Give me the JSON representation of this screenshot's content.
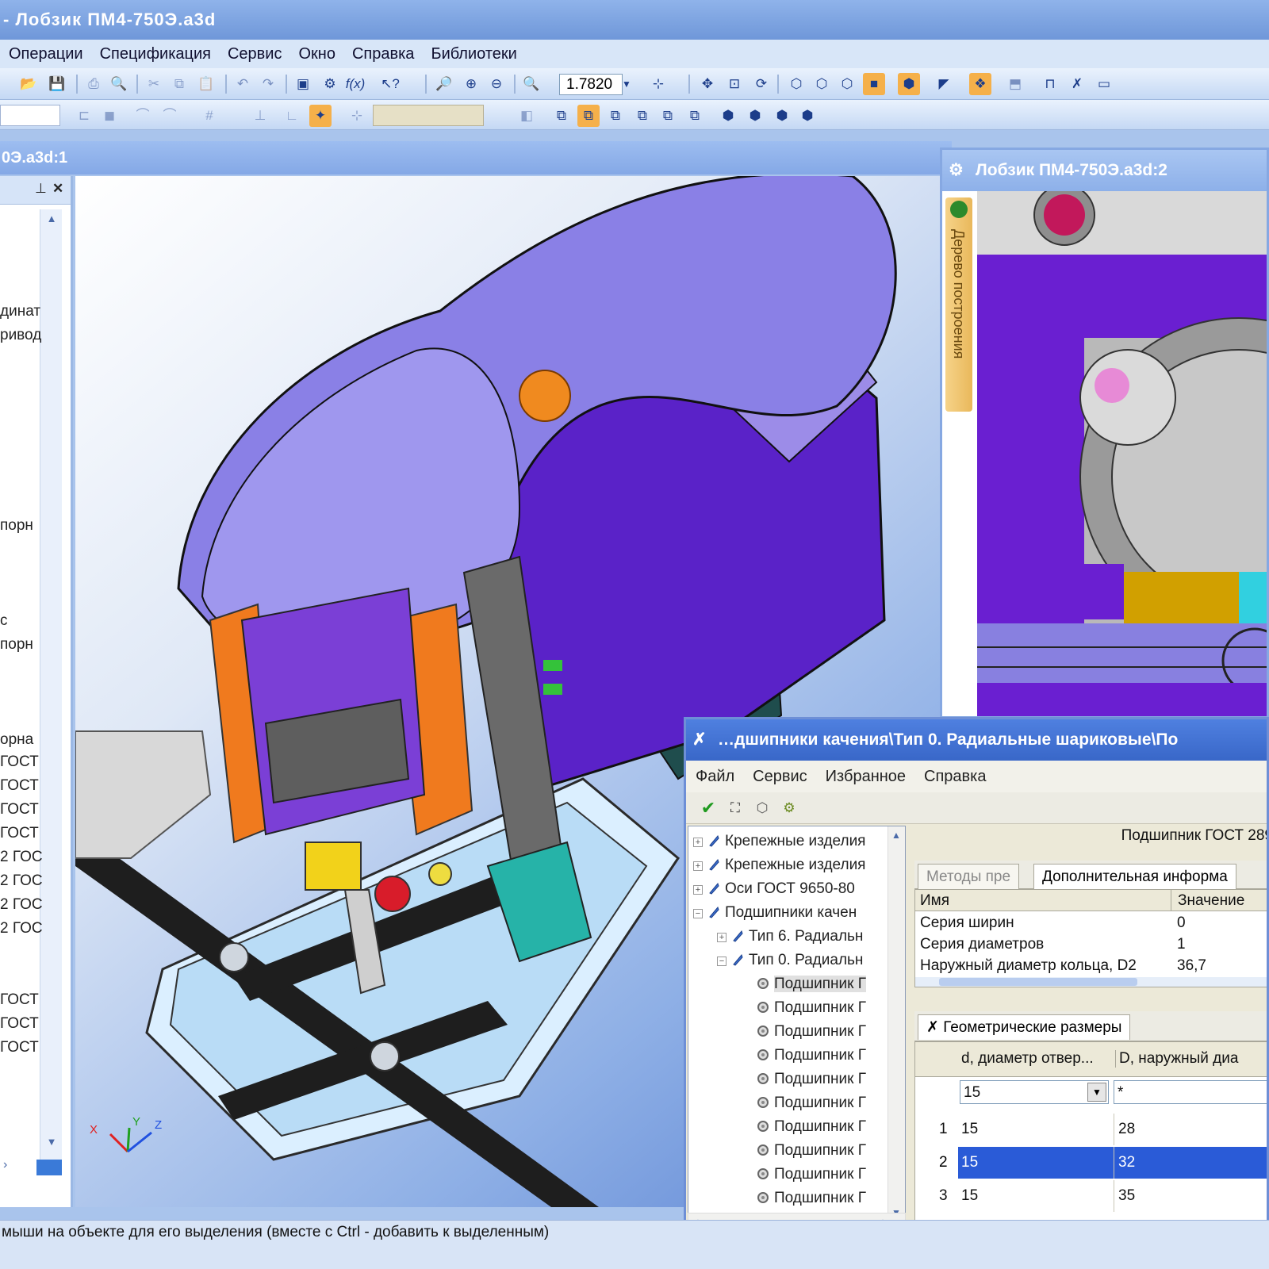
{
  "window": {
    "title": "- Лобзик ПМ4-750Э.a3d"
  },
  "menu": [
    "Операции",
    "Спецификация",
    "Сервис",
    "Окно",
    "Справка",
    "Библиотеки"
  ],
  "toolbar": {
    "zoom_value": "1.7820"
  },
  "doc1": {
    "title": "0Э.a3d:1"
  },
  "left_panel": {
    "items": [
      "динат",
      "ривод",
      "порн",
      "с",
      "порн",
      "орна",
      "ГОСТ",
      "ГОСТ",
      "ГОСТ",
      "ГОСТ",
      "2 ГОС",
      "2 ГОС",
      "2 ГОС",
      "2 ГОС",
      "ГОСТ",
      "ГОСТ",
      "ГОСТ"
    ]
  },
  "axes": {
    "x": "X",
    "y": "Y",
    "z": "Z"
  },
  "doc2": {
    "title": "Лобзик ПМ4-750Э.a3d:2",
    "tree_tab": "Дерево построения"
  },
  "dialog": {
    "title": "…дшипники качения\\Тип 0. Радиальные шариковые\\По",
    "menu": [
      "Файл",
      "Сервис",
      "Избранное",
      "Справка"
    ],
    "tree": [
      {
        "label": "Крепежные изделия",
        "indent": 0,
        "exp": "+"
      },
      {
        "label": "Крепежные изделия",
        "indent": 0,
        "exp": "+"
      },
      {
        "label": "Оси ГОСТ 9650-80",
        "indent": 0,
        "exp": "+"
      },
      {
        "label": "Подшипники качен",
        "indent": 0,
        "exp": "−"
      },
      {
        "label": "Тип 6. Радиальн",
        "indent": 1,
        "exp": "+"
      },
      {
        "label": "Тип 0. Радиальн",
        "indent": 1,
        "exp": "−"
      },
      {
        "label": "Подшипник Г",
        "indent": 2,
        "exp": "",
        "selected": true
      },
      {
        "label": "Подшипник Г",
        "indent": 2,
        "exp": ""
      },
      {
        "label": "Подшипник Г",
        "indent": 2,
        "exp": ""
      },
      {
        "label": "Подшипник Г",
        "indent": 2,
        "exp": ""
      },
      {
        "label": "Подшипник Г",
        "indent": 2,
        "exp": ""
      },
      {
        "label": "Подшипник Г",
        "indent": 2,
        "exp": ""
      },
      {
        "label": "Подшипник Г",
        "indent": 2,
        "exp": ""
      },
      {
        "label": "Подшипник Г",
        "indent": 2,
        "exp": ""
      },
      {
        "label": "Подшипник Г",
        "indent": 2,
        "exp": ""
      },
      {
        "label": "Подшипник Г",
        "indent": 2,
        "exp": ""
      }
    ],
    "item_title": "Подшипник ГОСТ 289",
    "tabs": [
      "Методы пре",
      "Дополнительная информа"
    ],
    "prop_headers": [
      "Имя",
      "Значение"
    ],
    "props": [
      {
        "name": "Серия ширин",
        "value": "0"
      },
      {
        "name": "Серия диаметров",
        "value": "1"
      },
      {
        "name": "Наружный диаметр кольца, D2",
        "value": "36,7"
      }
    ],
    "geo_tab": "Геометрические размеры",
    "geo_headers": [
      "d, диаметр отвер...",
      "D, наружный диа"
    ],
    "geo_filter": [
      "15",
      "*"
    ],
    "geo_rows": [
      {
        "n": "1",
        "d": "15",
        "D": "28"
      },
      {
        "n": "2",
        "d": "15",
        "D": "32",
        "selected": true
      },
      {
        "n": "3",
        "d": "15",
        "D": "35"
      }
    ]
  },
  "status": {
    "text": "мыши на объекте для его выделения (вместе с Ctrl - добавить к выделенным)"
  }
}
